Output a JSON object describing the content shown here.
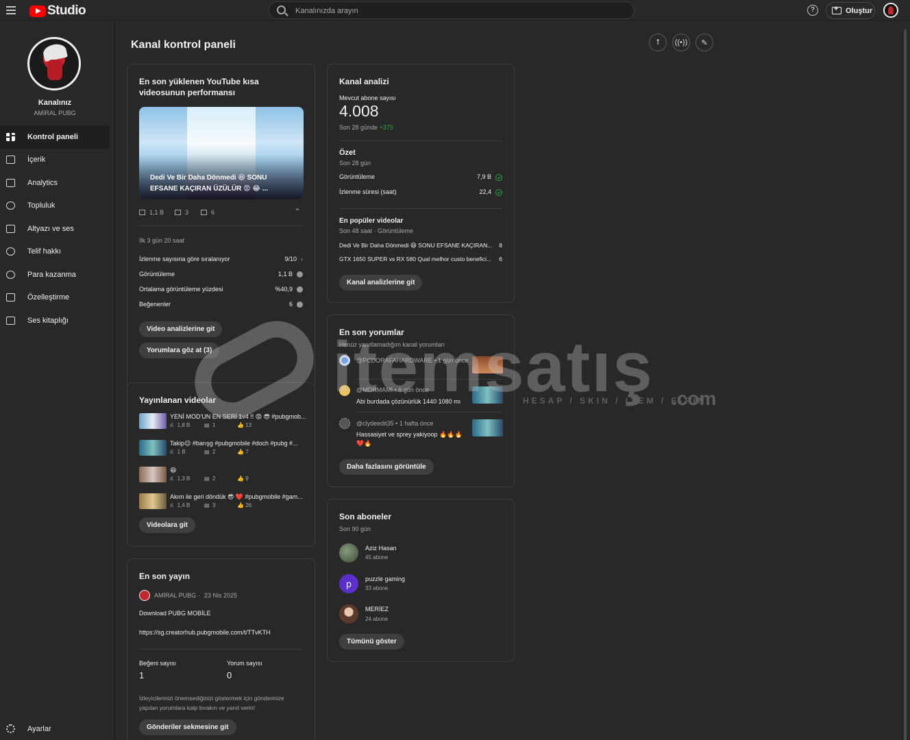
{
  "topbar": {
    "logo_text": "Studio",
    "search_placeholder": "Kanalınızda arayın",
    "help_symbol": "?",
    "create_label": "Oluştur"
  },
  "sidebar": {
    "channel_label": "Kanalınız",
    "channel_name": "AMİRAL PUBG",
    "items": [
      {
        "label": "Kontrol paneli",
        "icon": "dashboard-icon",
        "active": true
      },
      {
        "label": "İçerik",
        "icon": "content-icon"
      },
      {
        "label": "Analytics",
        "icon": "analytics-icon"
      },
      {
        "label": "Topluluk",
        "icon": "community-icon"
      },
      {
        "label": "Altyazı ve ses",
        "icon": "subtitles-icon"
      },
      {
        "label": "Telif hakkı",
        "icon": "copyright-icon"
      },
      {
        "label": "Para kazanma",
        "icon": "monetization-icon"
      },
      {
        "label": "Özelleştirme",
        "icon": "customization-icon"
      },
      {
        "label": "Ses kitaplığı",
        "icon": "audio-library-icon"
      }
    ],
    "settings_label": "Ayarlar"
  },
  "main": {
    "title": "Kanal kontrol paneli",
    "header_icons": [
      "upload-icon",
      "live-icon",
      "post-icon"
    ]
  },
  "latest_short": {
    "title": "En son yüklenen YouTube kısa videosunun performansı",
    "thumb_caption": "Dedi Ve Bir Daha Dönmedi 😆 SONU EFSANE KAÇIRAN ÜZÜLÜR 😡 😂 ...",
    "views": "1,1 B",
    "comments": "3",
    "likes": "6",
    "period": "İlk 3 gün 20 saat",
    "rows": [
      {
        "label": "İzlenme sayısına göre sıralanıyor",
        "value": "9/10"
      },
      {
        "label": "Görüntüleme",
        "value": "1,1 B"
      },
      {
        "label": "Ortalama görüntüleme yüzdesi",
        "value": "%40,9"
      },
      {
        "label": "Beğenenler",
        "value": "6"
      }
    ],
    "btn_analytics": "Video analizlerine git",
    "btn_comments": "Yorumlara göz at (3)"
  },
  "published": {
    "title": "Yayınlanan videolar",
    "videos": [
      {
        "title": "YENİ MOD'UN EN SERİ 1v4 !! 😡 😎 #pubgmob...",
        "views": "1,8 B",
        "comments": "1",
        "likes": "13"
      },
      {
        "title": "Takip😉 #barışg #pubgmobile #doch #pubg #...",
        "views": "1 B",
        "comments": "2",
        "likes": "7"
      },
      {
        "title": "😆",
        "views": "1,3 B",
        "comments": "2",
        "likes": "9"
      },
      {
        "title": "Akım ile geri döndük 😎 ❤️ #pubgmobile #gam...",
        "views": "1,4 B",
        "comments": "3",
        "likes": "26"
      }
    ],
    "btn": "Videolara git"
  },
  "latest_post": {
    "title": "En son yayın",
    "author": "AMİRAL PUBG",
    "date": "23 Nis 2025",
    "body1": "Download PUBG MOBİLE",
    "body2": "https://sg.creatorhub.pubgmobile.com/t/TTvKTH",
    "likes_label": "Beğeni sayısı",
    "likes": "1",
    "comments_label": "Yorum sayısı",
    "comments": "0",
    "note": "İzleyicilerinizi önemsediğinizi göstermek için gönderinize yapılan yorumlara kalp bırakın ve yanıt verin!",
    "btn": "Gönderiler sekmesine git"
  },
  "analytics": {
    "title": "Kanal analizi",
    "subs_label": "Mevcut abone sayısı",
    "subs": "4.008",
    "subs_change_label": "Son 28 günde",
    "subs_change": "+375",
    "summary_title": "Özet",
    "summary_period": "Son 28 gün",
    "summary_rows": [
      {
        "label": "Görüntüleme",
        "value": "7,9 B"
      },
      {
        "label": "İzlenme süresi (saat)",
        "value": "22,4"
      }
    ],
    "top_title": "En popüler videolar",
    "top_period": "Son 48 saat · Görüntüleme",
    "top_rows": [
      {
        "label": "Dedi Ve Bir Daha Dönmedi 😆 SONU EFSANE KAÇIRAN...",
        "value": "8"
      },
      {
        "label": "GTX 1650 SUPER vs RX 580 Qual melhor custo benefici...",
        "value": "6"
      }
    ],
    "btn": "Kanal analizlerine git"
  },
  "comments": {
    "title": "En son yorumlar",
    "subtitle": "Henüz yanıtlamadığım kanal yorumları",
    "items": [
      {
        "author": "@PCDORAFAHARDWARE",
        "time": "1 gün önce",
        "text": ""
      },
      {
        "author": "@MDRMAMI",
        "time": "6 gün önce",
        "text": "Abi burdada çözünürlük 1440 1080 mı"
      },
      {
        "author": "@clydeedit35",
        "time": "1 hafta önce",
        "text": "Hassasiyet ve sprey yakiyoop 🔥🔥🔥",
        "text2": "❤️🔥"
      }
    ],
    "btn": "Daha fazlasını görüntüle"
  },
  "subscribers": {
    "title": "Son aboneler",
    "period": "Son 90 gün",
    "items": [
      {
        "name": "Aziz Hasan",
        "subs": "45 abone"
      },
      {
        "name": "puzzle gaming",
        "subs": "33 abone",
        "initial": "p"
      },
      {
        "name": "MERİEZ",
        "subs": "24 abone"
      }
    ],
    "btn": "Tümünü göster"
  },
  "watermark": {
    "word": "itemsatış",
    "tagline": "HESAP / SKIN / ITEM / E-PIN",
    "suffix": ".com"
  }
}
